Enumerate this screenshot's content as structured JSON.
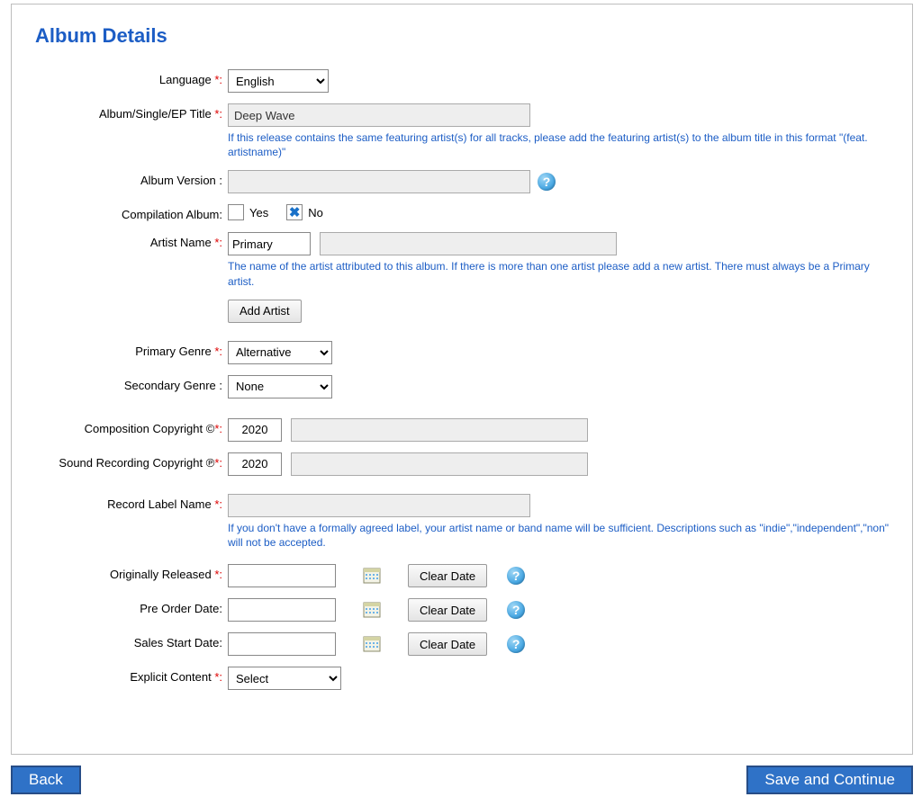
{
  "title": "Album Details",
  "labels": {
    "language": "Language ",
    "albumTitle": "Album/Single/EP Title ",
    "albumVersion": "Album Version :",
    "compilation": "Compilation Album:",
    "artistName": "Artist Name ",
    "primaryGenre": "Primary Genre ",
    "secondaryGenre": "Secondary Genre :",
    "compCopyright": "Composition Copyright ©",
    "soundCopyright": "Sound Recording Copyright ℗",
    "recordLabel": "Record Label Name ",
    "origReleased": "Originally Released ",
    "preOrder": "Pre Order Date:",
    "salesStart": "Sales Start Date:",
    "explicit": "Explicit Content "
  },
  "reqColon": "*:",
  "values": {
    "language": "English",
    "albumTitle": "Deep Wave",
    "albumVersion": "",
    "compilationYes": false,
    "compilationNo": true,
    "artistRole": "Primary",
    "artistName": "",
    "primaryGenre": "Alternative",
    "secondaryGenre": "None",
    "compYear": "2020",
    "compOwner": "",
    "soundYear": "2020",
    "soundOwner": "",
    "recordLabel": "",
    "origReleased": "",
    "preOrder": "",
    "salesStart": "",
    "explicit": "Select"
  },
  "text": {
    "yes": "Yes",
    "no": "No",
    "addArtist": "Add Artist",
    "clearDate": "Clear Date",
    "back": "Back",
    "saveContinue": "Save and Continue"
  },
  "help": {
    "albumTitle": "If this release contains the same featuring artist(s) for all tracks, please add the featuring artist(s) to the album title in this format \"(feat. artistname)\"",
    "artistName": "The name of the artist attributed to this album. If there is more than one artist please add a new artist. There must always be a Primary artist.",
    "recordLabel": "If you don't have a formally agreed label, your artist name or band name will be sufficient. Descriptions such as \"indie\",\"independent\",\"non\" will not be accepted."
  }
}
